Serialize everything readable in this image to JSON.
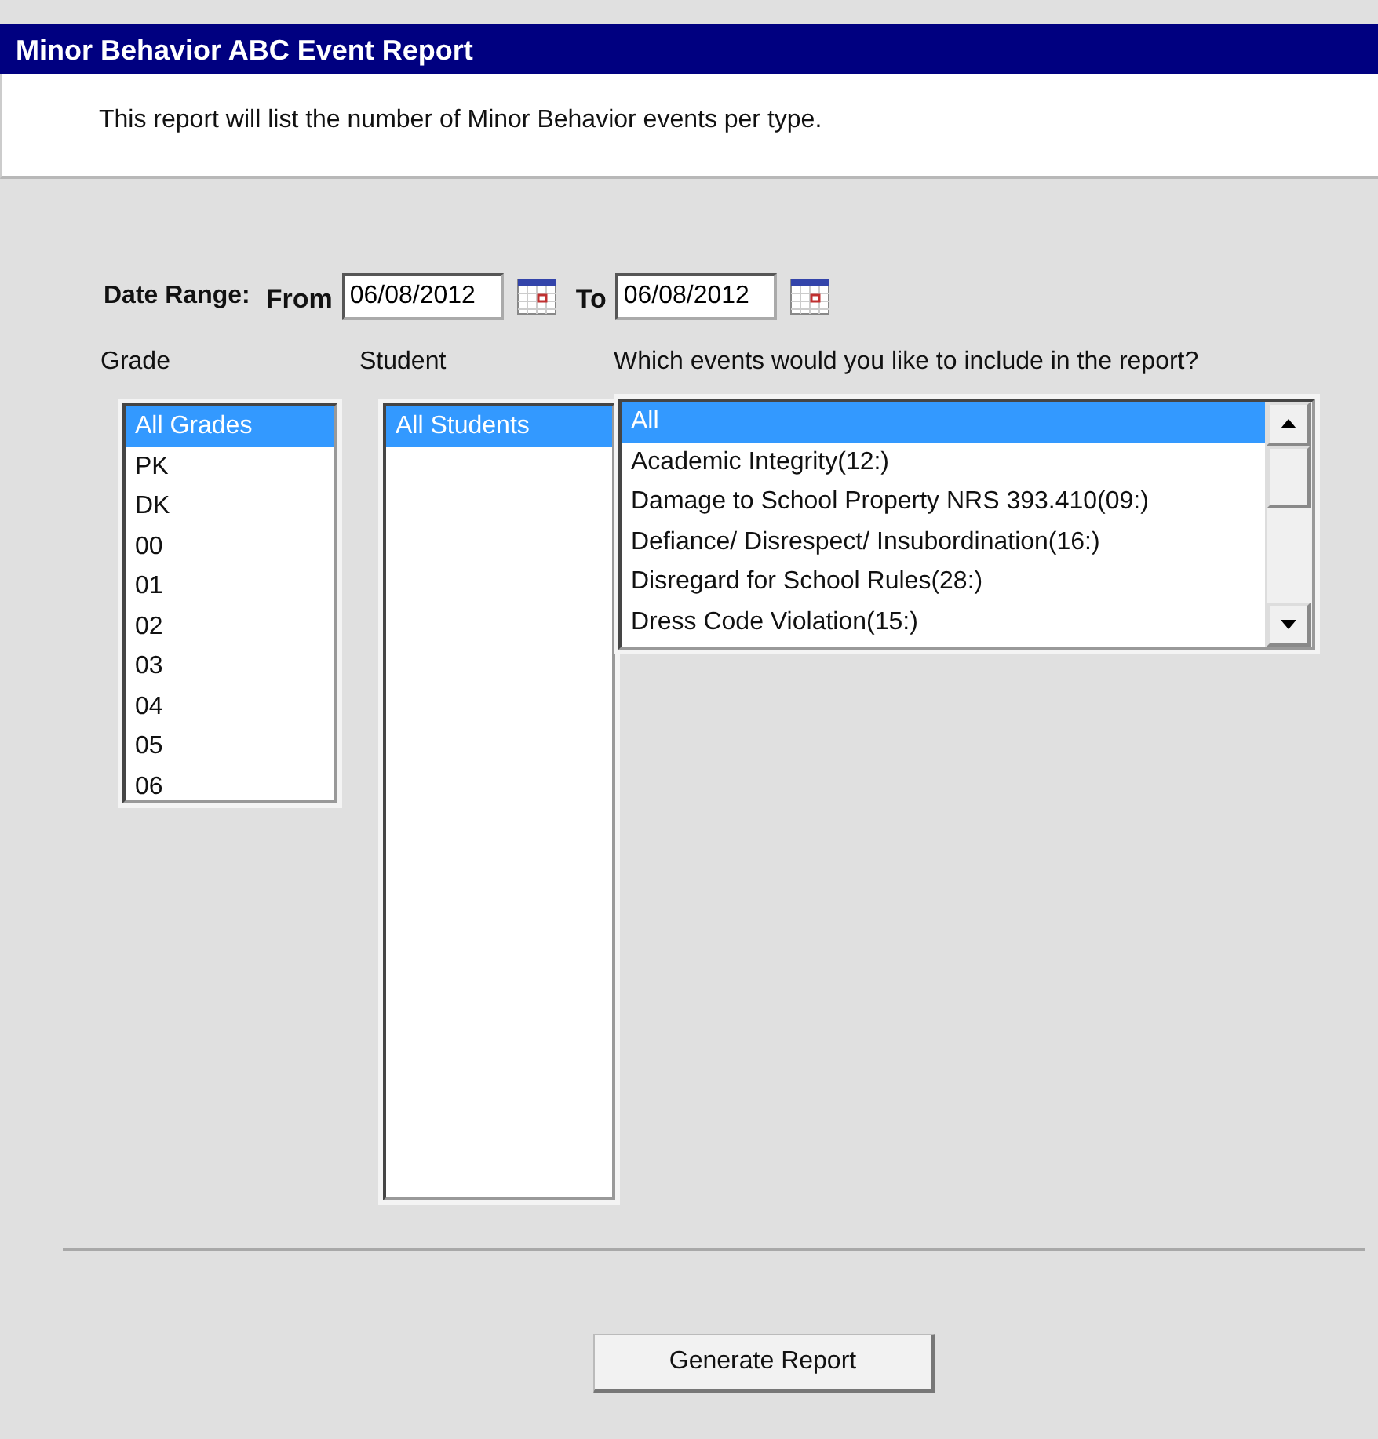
{
  "header": {
    "title": "Minor Behavior ABC Event Report",
    "description": "This report will list the number of Minor Behavior events per type."
  },
  "date_range": {
    "label": "Date Range:",
    "from_label": "From",
    "from_value": "06/08/2012",
    "to_label": "To",
    "to_value": "06/08/2012"
  },
  "grade": {
    "label": "Grade",
    "items": [
      {
        "text": "All Grades",
        "selected": true
      },
      {
        "text": "PK",
        "selected": false
      },
      {
        "text": "DK",
        "selected": false
      },
      {
        "text": "00",
        "selected": false
      },
      {
        "text": "01",
        "selected": false
      },
      {
        "text": "02",
        "selected": false
      },
      {
        "text": "03",
        "selected": false
      },
      {
        "text": "04",
        "selected": false
      },
      {
        "text": "05",
        "selected": false
      },
      {
        "text": "06",
        "selected": false
      }
    ]
  },
  "student": {
    "label": "Student",
    "items": [
      {
        "text": "All Students",
        "selected": true
      }
    ]
  },
  "events": {
    "label": "Which events would you like to include in the report?",
    "items": [
      {
        "text": "All",
        "selected": true
      },
      {
        "text": "Academic Integrity(12:)",
        "selected": false
      },
      {
        "text": "Damage to School Property NRS 393.410(09:)",
        "selected": false
      },
      {
        "text": "Defiance/ Disrespect/ Insubordination(16:)",
        "selected": false
      },
      {
        "text": "Disregard for School Rules(28:)",
        "selected": false
      },
      {
        "text": "Dress Code Violation(15:)",
        "selected": false
      }
    ]
  },
  "buttons": [
    "Generate Report"
  ]
}
